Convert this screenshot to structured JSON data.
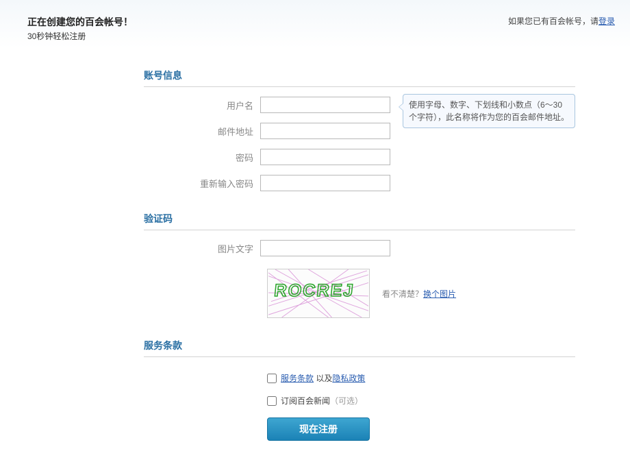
{
  "header": {
    "title": "正在创建您的百会帐号！",
    "subtitle": "30秒钟轻松注册",
    "login_prompt_text": "如果您已有百会帐号，请",
    "login_link": "登录"
  },
  "sections": {
    "account": "账号信息",
    "captcha": "验证码",
    "terms": "服务条款"
  },
  "fields": {
    "username_label": "用户名",
    "email_label": "邮件地址",
    "password_label": "密码",
    "password_confirm_label": "重新输入密码",
    "captcha_text_label": "图片文字"
  },
  "tooltip": {
    "username": "使用字母、数字、下划线和小数点（6～30个字符），此名称将作为您的百会邮件地址。"
  },
  "captcha": {
    "image_text": "ROCREJ",
    "hint_prefix": "看不清楚？",
    "hint_link": "换个图片"
  },
  "terms": {
    "tos_link": "服务条款",
    "joiner": " 以及",
    "privacy_link": "隐私政策",
    "newsletter_label_prefix": "订阅百会新闻",
    "newsletter_optional": "（可选）"
  },
  "submit": {
    "label": "现在注册"
  }
}
